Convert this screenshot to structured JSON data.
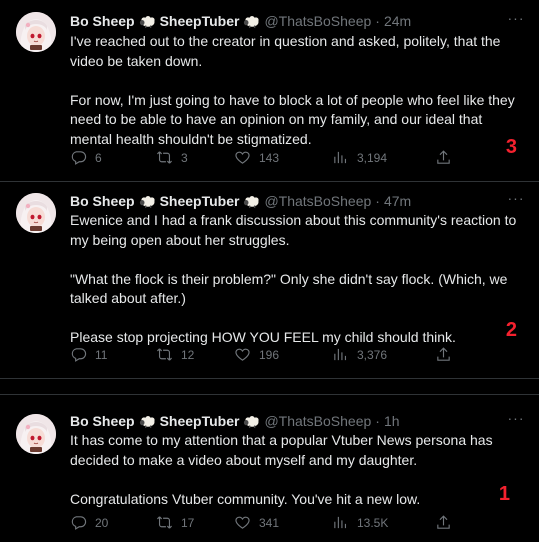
{
  "tweets": [
    {
      "display_name": "Bo Sheep",
      "display_name_suffix": "SheepTuber",
      "handle": "@ThatsBoSheep",
      "separator": "·",
      "time": "24m",
      "more": "···",
      "paragraphs": [
        "I've reached out to the creator in question and asked, politely, that the video be taken down.",
        "For now, I'm just going to have to block a lot of people who feel like they need to be able to have an opinion on my family, and our ideal that mental health shouldn't be stigmatized."
      ],
      "replies": "6",
      "retweets": "3",
      "likes": "143",
      "views": "3,194",
      "marker": "3"
    },
    {
      "display_name": "Bo Sheep",
      "display_name_suffix": "SheepTuber",
      "handle": "@ThatsBoSheep",
      "separator": "·",
      "time": "47m",
      "more": "···",
      "paragraphs": [
        "Ewenice and I had a frank discussion about this community's reaction to my being open about her struggles.",
        "\"What the flock is their problem?\" Only she didn't say flock. (Which, we talked about after.)",
        "Please stop projecting HOW YOU FEEL my child should think."
      ],
      "replies": "11",
      "retweets": "12",
      "likes": "196",
      "views": "3,376",
      "marker": "2"
    },
    {
      "display_name": "Bo Sheep",
      "display_name_suffix": "SheepTuber",
      "handle": "@ThatsBoSheep",
      "separator": "·",
      "time": "1h",
      "more": "···",
      "paragraphs": [
        "It has come to my attention that a popular Vtuber News persona has decided to make a video about myself and my daughter.",
        "Congratulations Vtuber community. You've hit a new low."
      ],
      "replies": "20",
      "retweets": "17",
      "likes": "341",
      "views": "13.5K",
      "marker": "1"
    }
  ],
  "colors": {
    "background": "#000000",
    "text": "#e7e9ea",
    "muted": "#71767b",
    "divider": "#2f3336",
    "marker": "#f4212e"
  }
}
